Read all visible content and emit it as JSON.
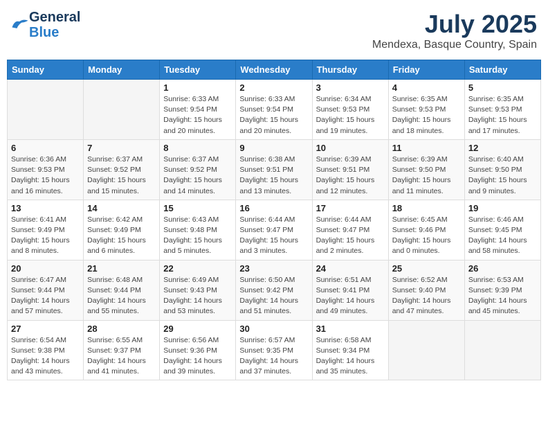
{
  "header": {
    "logo_general": "General",
    "logo_blue": "Blue",
    "title": "July 2025",
    "subtitle": "Mendexa, Basque Country, Spain"
  },
  "weekdays": [
    "Sunday",
    "Monday",
    "Tuesday",
    "Wednesday",
    "Thursday",
    "Friday",
    "Saturday"
  ],
  "weeks": [
    [
      {
        "day": "",
        "sunrise": "",
        "sunset": "",
        "daylight": ""
      },
      {
        "day": "",
        "sunrise": "",
        "sunset": "",
        "daylight": ""
      },
      {
        "day": "1",
        "sunrise": "Sunrise: 6:33 AM",
        "sunset": "Sunset: 9:54 PM",
        "daylight": "Daylight: 15 hours and 20 minutes."
      },
      {
        "day": "2",
        "sunrise": "Sunrise: 6:33 AM",
        "sunset": "Sunset: 9:54 PM",
        "daylight": "Daylight: 15 hours and 20 minutes."
      },
      {
        "day": "3",
        "sunrise": "Sunrise: 6:34 AM",
        "sunset": "Sunset: 9:53 PM",
        "daylight": "Daylight: 15 hours and 19 minutes."
      },
      {
        "day": "4",
        "sunrise": "Sunrise: 6:35 AM",
        "sunset": "Sunset: 9:53 PM",
        "daylight": "Daylight: 15 hours and 18 minutes."
      },
      {
        "day": "5",
        "sunrise": "Sunrise: 6:35 AM",
        "sunset": "Sunset: 9:53 PM",
        "daylight": "Daylight: 15 hours and 17 minutes."
      }
    ],
    [
      {
        "day": "6",
        "sunrise": "Sunrise: 6:36 AM",
        "sunset": "Sunset: 9:53 PM",
        "daylight": "Daylight: 15 hours and 16 minutes."
      },
      {
        "day": "7",
        "sunrise": "Sunrise: 6:37 AM",
        "sunset": "Sunset: 9:52 PM",
        "daylight": "Daylight: 15 hours and 15 minutes."
      },
      {
        "day": "8",
        "sunrise": "Sunrise: 6:37 AM",
        "sunset": "Sunset: 9:52 PM",
        "daylight": "Daylight: 15 hours and 14 minutes."
      },
      {
        "day": "9",
        "sunrise": "Sunrise: 6:38 AM",
        "sunset": "Sunset: 9:51 PM",
        "daylight": "Daylight: 15 hours and 13 minutes."
      },
      {
        "day": "10",
        "sunrise": "Sunrise: 6:39 AM",
        "sunset": "Sunset: 9:51 PM",
        "daylight": "Daylight: 15 hours and 12 minutes."
      },
      {
        "day": "11",
        "sunrise": "Sunrise: 6:39 AM",
        "sunset": "Sunset: 9:50 PM",
        "daylight": "Daylight: 15 hours and 11 minutes."
      },
      {
        "day": "12",
        "sunrise": "Sunrise: 6:40 AM",
        "sunset": "Sunset: 9:50 PM",
        "daylight": "Daylight: 15 hours and 9 minutes."
      }
    ],
    [
      {
        "day": "13",
        "sunrise": "Sunrise: 6:41 AM",
        "sunset": "Sunset: 9:49 PM",
        "daylight": "Daylight: 15 hours and 8 minutes."
      },
      {
        "day": "14",
        "sunrise": "Sunrise: 6:42 AM",
        "sunset": "Sunset: 9:49 PM",
        "daylight": "Daylight: 15 hours and 6 minutes."
      },
      {
        "day": "15",
        "sunrise": "Sunrise: 6:43 AM",
        "sunset": "Sunset: 9:48 PM",
        "daylight": "Daylight: 15 hours and 5 minutes."
      },
      {
        "day": "16",
        "sunrise": "Sunrise: 6:44 AM",
        "sunset": "Sunset: 9:47 PM",
        "daylight": "Daylight: 15 hours and 3 minutes."
      },
      {
        "day": "17",
        "sunrise": "Sunrise: 6:44 AM",
        "sunset": "Sunset: 9:47 PM",
        "daylight": "Daylight: 15 hours and 2 minutes."
      },
      {
        "day": "18",
        "sunrise": "Sunrise: 6:45 AM",
        "sunset": "Sunset: 9:46 PM",
        "daylight": "Daylight: 15 hours and 0 minutes."
      },
      {
        "day": "19",
        "sunrise": "Sunrise: 6:46 AM",
        "sunset": "Sunset: 9:45 PM",
        "daylight": "Daylight: 14 hours and 58 minutes."
      }
    ],
    [
      {
        "day": "20",
        "sunrise": "Sunrise: 6:47 AM",
        "sunset": "Sunset: 9:44 PM",
        "daylight": "Daylight: 14 hours and 57 minutes."
      },
      {
        "day": "21",
        "sunrise": "Sunrise: 6:48 AM",
        "sunset": "Sunset: 9:44 PM",
        "daylight": "Daylight: 14 hours and 55 minutes."
      },
      {
        "day": "22",
        "sunrise": "Sunrise: 6:49 AM",
        "sunset": "Sunset: 9:43 PM",
        "daylight": "Daylight: 14 hours and 53 minutes."
      },
      {
        "day": "23",
        "sunrise": "Sunrise: 6:50 AM",
        "sunset": "Sunset: 9:42 PM",
        "daylight": "Daylight: 14 hours and 51 minutes."
      },
      {
        "day": "24",
        "sunrise": "Sunrise: 6:51 AM",
        "sunset": "Sunset: 9:41 PM",
        "daylight": "Daylight: 14 hours and 49 minutes."
      },
      {
        "day": "25",
        "sunrise": "Sunrise: 6:52 AM",
        "sunset": "Sunset: 9:40 PM",
        "daylight": "Daylight: 14 hours and 47 minutes."
      },
      {
        "day": "26",
        "sunrise": "Sunrise: 6:53 AM",
        "sunset": "Sunset: 9:39 PM",
        "daylight": "Daylight: 14 hours and 45 minutes."
      }
    ],
    [
      {
        "day": "27",
        "sunrise": "Sunrise: 6:54 AM",
        "sunset": "Sunset: 9:38 PM",
        "daylight": "Daylight: 14 hours and 43 minutes."
      },
      {
        "day": "28",
        "sunrise": "Sunrise: 6:55 AM",
        "sunset": "Sunset: 9:37 PM",
        "daylight": "Daylight: 14 hours and 41 minutes."
      },
      {
        "day": "29",
        "sunrise": "Sunrise: 6:56 AM",
        "sunset": "Sunset: 9:36 PM",
        "daylight": "Daylight: 14 hours and 39 minutes."
      },
      {
        "day": "30",
        "sunrise": "Sunrise: 6:57 AM",
        "sunset": "Sunset: 9:35 PM",
        "daylight": "Daylight: 14 hours and 37 minutes."
      },
      {
        "day": "31",
        "sunrise": "Sunrise: 6:58 AM",
        "sunset": "Sunset: 9:34 PM",
        "daylight": "Daylight: 14 hours and 35 minutes."
      },
      {
        "day": "",
        "sunrise": "",
        "sunset": "",
        "daylight": ""
      },
      {
        "day": "",
        "sunrise": "",
        "sunset": "",
        "daylight": ""
      }
    ]
  ]
}
